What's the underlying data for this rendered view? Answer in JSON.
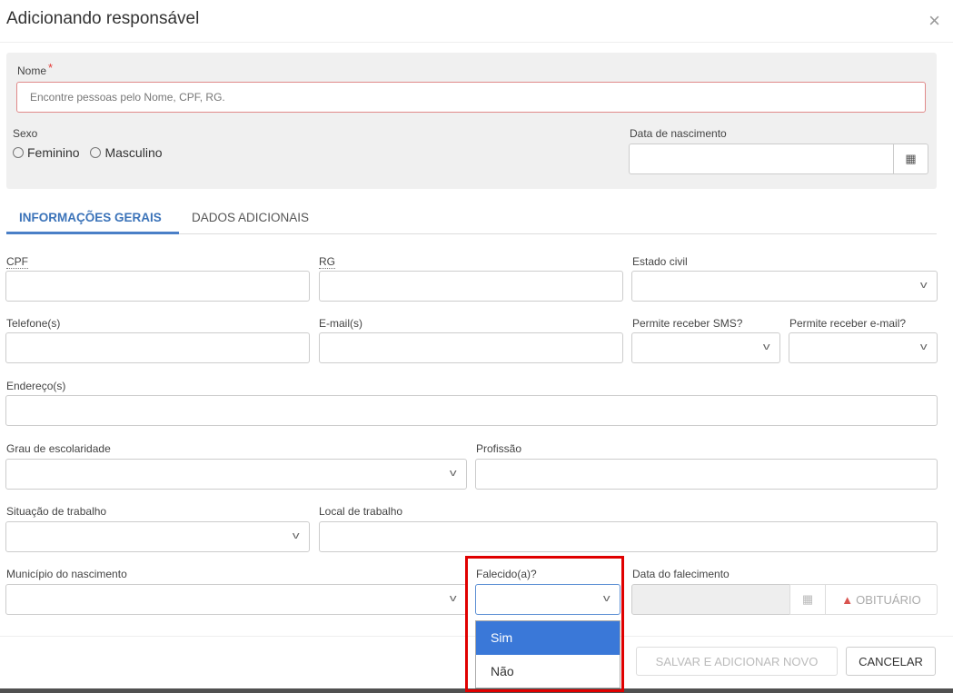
{
  "modal": {
    "title": "Adicionando responsável",
    "close_glyph": "×"
  },
  "nome": {
    "label": "Nome",
    "required_mark": "*",
    "placeholder": "Encontre pessoas pelo Nome, CPF, RG."
  },
  "sexo": {
    "label": "Sexo",
    "options": [
      "Feminino",
      "Masculino"
    ]
  },
  "data_nascimento": {
    "label": "Data de nascimento",
    "value": ""
  },
  "tabs": [
    {
      "label": "INFORMAÇÕES GERAIS",
      "active": true
    },
    {
      "label": "DADOS ADICIONAIS",
      "active": false
    }
  ],
  "fields": {
    "cpf": "CPF",
    "rg": "RG",
    "estado_civil": "Estado civil",
    "telefones": "Telefone(s)",
    "emails": "E-mail(s)",
    "permite_sms": "Permite receber SMS?",
    "permite_email": "Permite receber e-mail?",
    "enderecos": "Endereço(s)",
    "grau_escolaridade": "Grau de escolaridade",
    "profissao": "Profissão",
    "situacao_trabalho": "Situação de trabalho",
    "local_trabalho": "Local de trabalho",
    "municipio_nascimento": "Município do nascimento",
    "falecido": "Falecido(a)?",
    "data_falecimento": "Data do falecimento"
  },
  "obituario_label": "OBITUÁRIO",
  "falecido_dropdown": {
    "options": [
      "Sim",
      "Não"
    ],
    "highlighted": "Sim"
  },
  "footer": {
    "save_new_label": "SALVAR E ADICIONAR NOVO",
    "cancel_label": "CANCELAR"
  },
  "colors": {
    "accent": "#3b73b9",
    "highlight_box": "#e00000",
    "dropdown_selected": "#3a78d8"
  }
}
